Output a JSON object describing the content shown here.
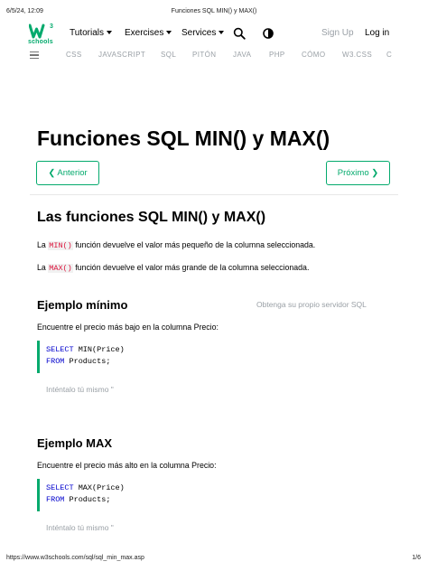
{
  "print": {
    "date": "6/5/24, 12:09",
    "doc_title": "Funciones SQL MIN() y MAX()",
    "url": "https://www.w3schools.com/sql/sql_min_max.asp",
    "page": "1/6"
  },
  "logo": {
    "sup": "3",
    "text": "schools"
  },
  "topnav": {
    "tutorials": "Tutorials",
    "exercises": "Exercises",
    "services": "Services",
    "signup": "Sign Up",
    "login": "Log in"
  },
  "subnav": [
    "CSS",
    "JAVASCRIPT",
    "SQL",
    "PITÓN",
    "JAVA",
    "PHP",
    "CÓMO",
    "W3.CSS",
    "C"
  ],
  "page": {
    "title": "Funciones SQL MIN() y MAX()",
    "prev_label": "❮ Anterior",
    "next_label": "Próximo ❯"
  },
  "intro": {
    "heading": "Las funciones SQL MIN() y MAX()",
    "p1_pre": "La",
    "p1_code": "MIN()",
    "p1_post": "función devuelve el valor más pequeño de la columna seleccionada.",
    "p2_pre": "La",
    "p2_code": "MAX()",
    "p2_post": "función devuelve el valor más grande de la columna seleccionada."
  },
  "example_min": {
    "heading": "Ejemplo mínimo",
    "side_link": "Obtenga su propio servidor SQL",
    "desc": "Encuentre el precio más bajo en la columna Precio:",
    "line1_kw": "SELECT",
    "line1_rest": " MIN(Price)",
    "line2_kw": "FROM",
    "line2_rest": " Products;",
    "try_label": "Inténtalo tú mismo \""
  },
  "example_max": {
    "heading": "Ejemplo MAX",
    "desc": "Encuentre el precio más alto en la columna Precio:",
    "line1_kw": "SELECT",
    "line1_rest": " MAX(Price)",
    "line2_kw": "FROM",
    "line2_rest": " Products;",
    "try_label": "Inténtalo tú mismo \""
  },
  "colors": {
    "accent": "#04AA6D",
    "keyword": "#0000cd",
    "inline_code": "#dc143c",
    "muted": "#9aa0a6"
  },
  "icons": [
    "w3schools-logo-icon",
    "caret-down-icon",
    "search-icon",
    "contrast-icon",
    "hamburger-menu-icon"
  ]
}
